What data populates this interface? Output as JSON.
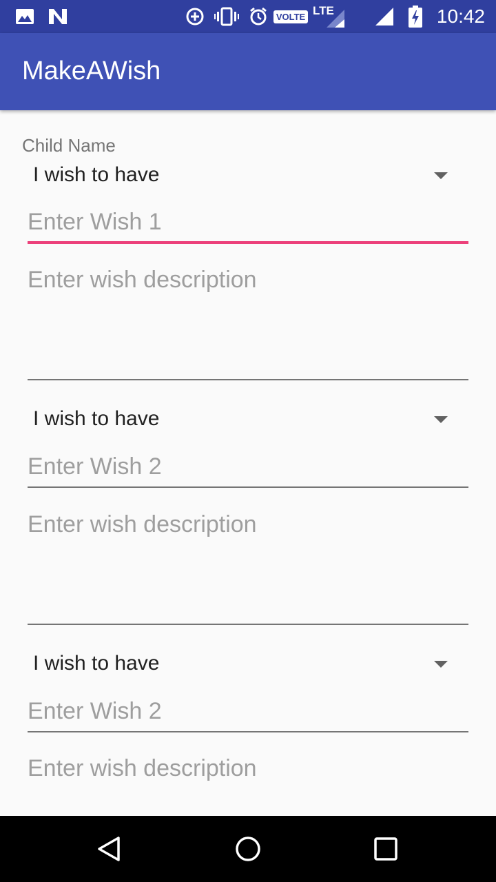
{
  "status_bar": {
    "time": "10:42",
    "volte_label": "VOLTE",
    "lte_label": "LTE",
    "icons": [
      "gallery-icon",
      "n-icon",
      "data-saver-icon",
      "vibrate-icon",
      "alarm-icon",
      "volte-icon",
      "signal-lte-icon",
      "signal-icon",
      "battery-charging-icon"
    ]
  },
  "app_bar": {
    "title": "MakeAWish"
  },
  "form": {
    "child_name_label": "Child Name",
    "wishes": [
      {
        "type_selected": "I wish to have",
        "wish_placeholder": "Enter Wish 1",
        "description_placeholder": "Enter wish description"
      },
      {
        "type_selected": "I wish to have",
        "wish_placeholder": "Enter Wish 2",
        "description_placeholder": "Enter wish description"
      },
      {
        "type_selected": "I wish to have",
        "wish_placeholder": "Enter Wish 2",
        "description_placeholder": "Enter wish description"
      }
    ]
  },
  "colors": {
    "status_bar": "#303f9f",
    "app_bar": "#3f51b5",
    "accent": "#ec407a",
    "background": "#fafafa"
  },
  "nav_bar": {
    "icons": [
      "back-icon",
      "home-icon",
      "recents-icon"
    ]
  }
}
